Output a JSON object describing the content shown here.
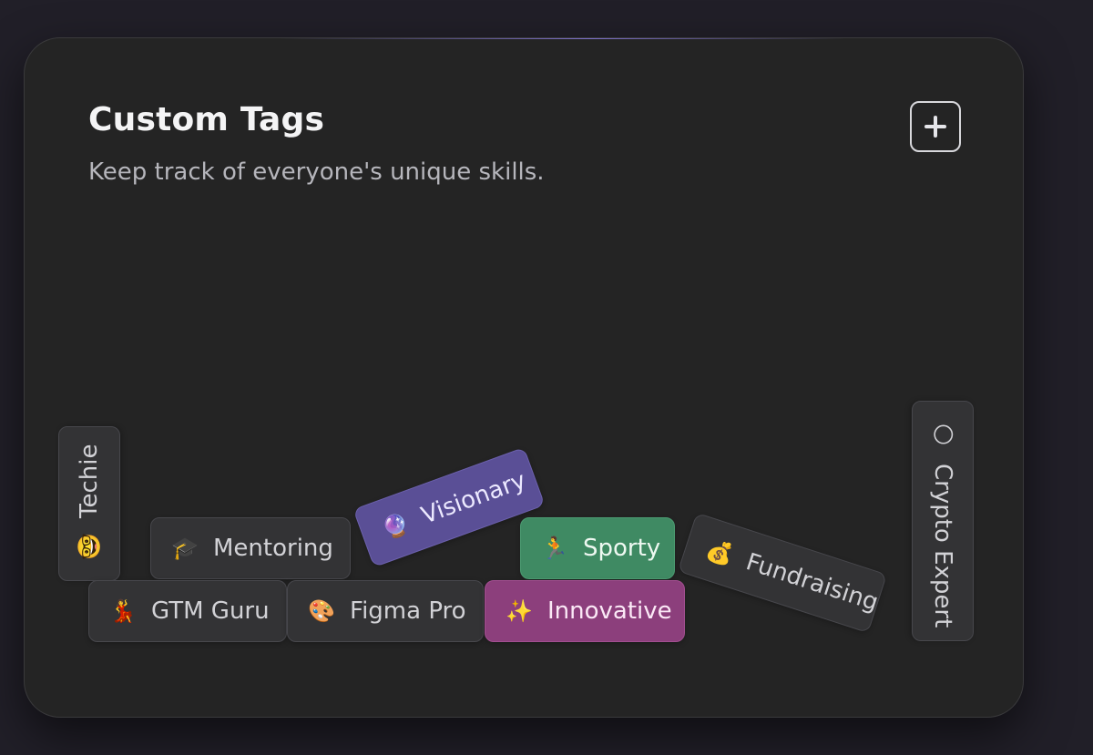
{
  "card": {
    "title": "Custom Tags",
    "subtitle": "Keep track of everyone's unique skills.",
    "add_button_icon": "plus-icon"
  },
  "tags": {
    "techie": {
      "icon": "🤓",
      "label": "Techie"
    },
    "mentoring": {
      "icon": "🎓",
      "label": "Mentoring"
    },
    "visionary": {
      "icon": "🔮",
      "label": "Visionary",
      "color": "#5a4f96"
    },
    "sporty": {
      "icon": "🏃",
      "label": "Sporty",
      "color": "#3f8a63"
    },
    "fundraising": {
      "icon": "💰",
      "label": "Fundraising"
    },
    "crypto": {
      "icon": "🌕",
      "label": "Crypto Expert"
    },
    "gtm": {
      "icon": "💃",
      "label": "GTM Guru"
    },
    "figma": {
      "icon": "🎨",
      "label": "Figma Pro"
    },
    "innovative": {
      "icon": "✨",
      "label": "Innovative",
      "color": "#8c3f7c"
    }
  }
}
